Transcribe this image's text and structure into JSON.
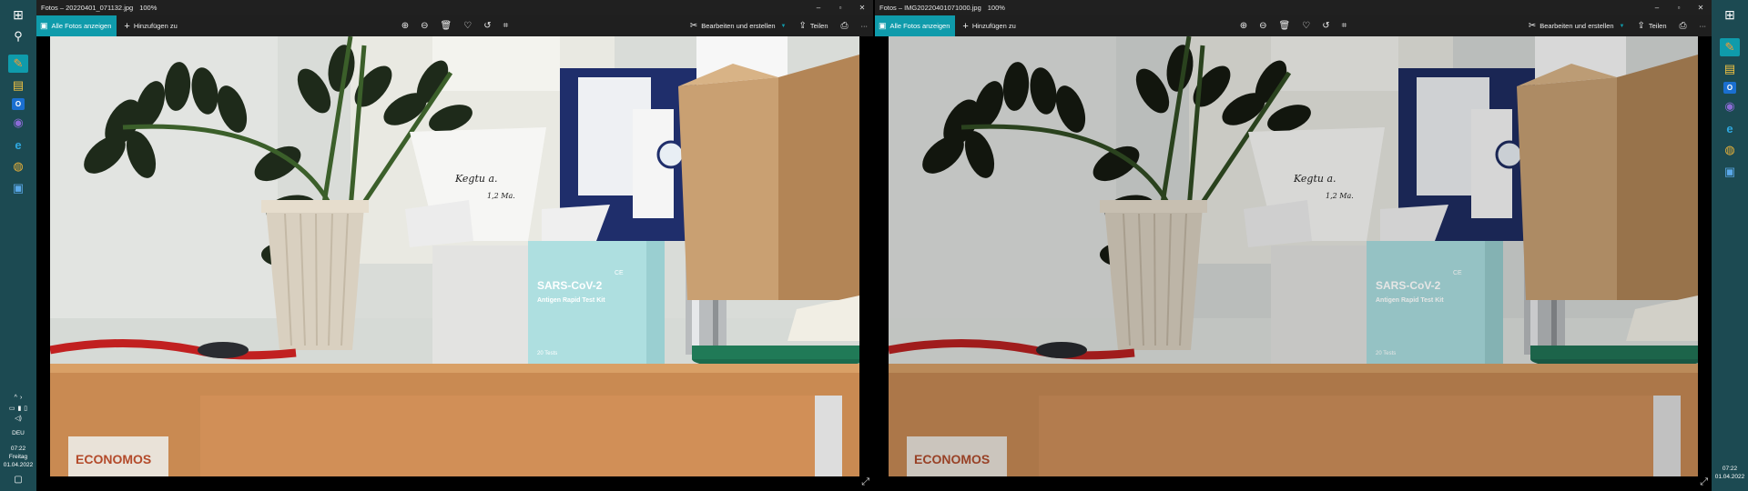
{
  "left_taskbar": {
    "icons": [
      "windows-start-icon",
      "search-icon",
      "app-icon-orange",
      "mail-icon",
      "outlook-icon",
      "teams-icon",
      "edge-icon",
      "chrome-icon",
      "photos-icon"
    ],
    "tray": {
      "chevron": "^",
      "lang": "DEU",
      "time": "07:22",
      "day": "Freitag",
      "date": "01.04.2022"
    }
  },
  "right_taskbar": {
    "tray": {
      "time": "07:22",
      "date": "01.04.2022"
    }
  },
  "window_left": {
    "title": "Fotos – 20220401_071132.jpg",
    "zoom": "100%",
    "all_photos": "Alle Fotos anzeigen",
    "add_to": "Hinzufügen zu",
    "edit_create": "Bearbeiten und erstellen",
    "share": "Teilen",
    "more": "···"
  },
  "window_right": {
    "title": "Fotos – IMG20220401071000.jpg",
    "zoom": "100%",
    "all_photos": "Alle Fotos anzeigen",
    "add_to": "Hinzufügen zu",
    "edit_create": "Bearbeiten und erstellen",
    "share": "Teilen",
    "more": "···"
  },
  "photo": {
    "note_line1": "Kegtu a.",
    "note_line2": "1,2 Ma.",
    "box_title": "SARS-CoV-2",
    "box_subtitle": "Antigen Rapid Test Kit",
    "box_corner": "CE",
    "box_footer": "20 Tests",
    "poster_text": "ECONOMOS"
  },
  "colors": {
    "accent": "#0f9bab",
    "taskbar": "#1c4a52",
    "titlebar": "#202020"
  }
}
